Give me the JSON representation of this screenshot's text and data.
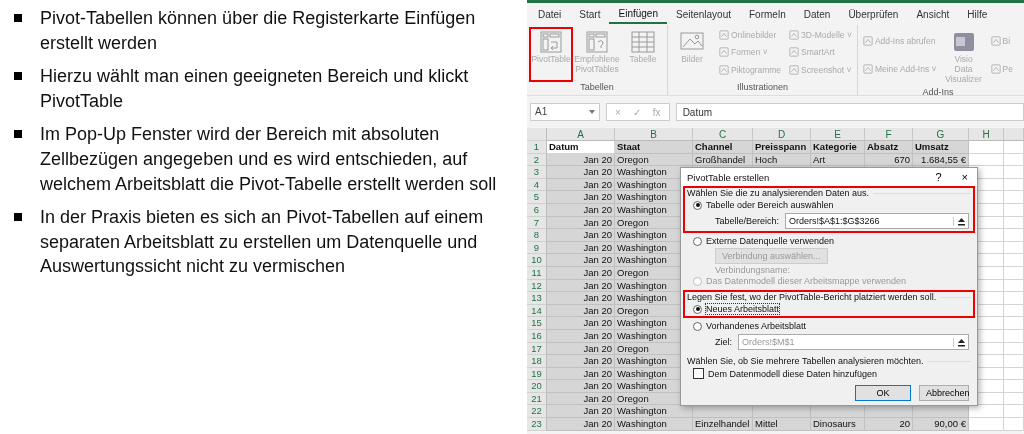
{
  "bullets": [
    "Pivot-Tabellen können über die Registerkarte Einfügen erstellt werden",
    "Hierzu wählt man einen geeigneten Bereich und klickt PivotTable",
    "Im Pop-Up Fenster wird der Bereich mit absoluten Zellbezügen angegeben und es wird entschieden, auf welchem Arbeitsblatt die Pivot-Tabelle erstellt werden soll",
    "In der Praxis bieten es sich an Pivot-Tabellen auf einem separaten Arbeitsblatt zu erstellen um Datenquelle und Auswertungssicht nicht zu vermischen"
  ],
  "excel": {
    "tabs": [
      {
        "label": "Datei",
        "selected": false
      },
      {
        "label": "Start",
        "selected": false
      },
      {
        "label": "Einfügen",
        "selected": true
      },
      {
        "label": "Seitenlayout",
        "selected": false
      },
      {
        "label": "Formeln",
        "selected": false
      },
      {
        "label": "Daten",
        "selected": false
      },
      {
        "label": "Überprüfen",
        "selected": false
      },
      {
        "label": "Ansicht",
        "selected": false
      },
      {
        "label": "Hilfe",
        "selected": false
      }
    ],
    "ribbon_groups": [
      {
        "label": "Tabellen",
        "items": [
          {
            "kind": "large",
            "label": "PivotTable",
            "highlighted": true
          },
          {
            "kind": "large",
            "label": "Empfohlene PivotTables",
            "highlighted": false
          },
          {
            "kind": "large",
            "label": "Tabelle",
            "highlighted": false
          }
        ]
      },
      {
        "label": "Illustrationen",
        "items": [
          {
            "kind": "large",
            "label": "Bilder",
            "highlighted": false
          },
          {
            "kind": "small",
            "label": "Onlinebilder",
            "highlighted": false
          },
          {
            "kind": "small",
            "label": "Formen ˅",
            "highlighted": false
          },
          {
            "kind": "small",
            "label": "Piktogramme",
            "highlighted": false
          },
          {
            "kind": "small",
            "label": "3D-Modelle ˅",
            "highlighted": false
          },
          {
            "kind": "small",
            "label": "SmartArt",
            "highlighted": false
          },
          {
            "kind": "small",
            "label": "Screenshot ˅",
            "highlighted": false
          }
        ]
      },
      {
        "label": "Add-Ins",
        "items": [
          {
            "kind": "small",
            "label": "Add-Ins abrufen",
            "highlighted": false
          },
          {
            "kind": "small",
            "label": "Meine Add-Ins ˅",
            "highlighted": false
          },
          {
            "kind": "large",
            "label": "Visio Data Visualizer",
            "highlighted": false
          },
          {
            "kind": "small",
            "label": "Bi",
            "highlighted": false
          },
          {
            "kind": "small",
            "label": "Pe",
            "highlighted": false
          }
        ]
      }
    ],
    "name_box": "A1",
    "formula_symbols": [
      "×",
      "✓",
      "fx"
    ],
    "formula": "Datum",
    "columns": [
      "A",
      "B",
      "C",
      "D",
      "E",
      "F",
      "G",
      "H"
    ],
    "rows": [
      {
        "num": "1",
        "kind": "header",
        "cells": [
          "Datum",
          "Staat",
          "Channel",
          "Preisspann",
          "Kategorie",
          "Absatz",
          "Umsatz"
        ]
      },
      {
        "num": "2",
        "kind": "data",
        "cells": [
          "Jan 20",
          "Oregon",
          "Großhandel",
          "Hoch",
          "Art",
          "670",
          "1.684,55 €"
        ]
      },
      {
        "num": "3",
        "kind": "data",
        "cells": [
          "Jan 20",
          "Washington"
        ]
      },
      {
        "num": "4",
        "kind": "data",
        "cells": [
          "Jan 20",
          "Washington"
        ]
      },
      {
        "num": "5",
        "kind": "data",
        "cells": [
          "Jan 20",
          "Washington"
        ]
      },
      {
        "num": "6",
        "kind": "data",
        "cells": [
          "Jan 20",
          "Washington"
        ]
      },
      {
        "num": "7",
        "kind": "data",
        "cells": [
          "Jan 20",
          "Oregon"
        ]
      },
      {
        "num": "8",
        "kind": "data",
        "cells": [
          "Jan 20",
          "Washington"
        ]
      },
      {
        "num": "9",
        "kind": "data",
        "cells": [
          "Jan 20",
          "Washington"
        ]
      },
      {
        "num": "10",
        "kind": "data",
        "cells": [
          "Jan 20",
          "Washington"
        ]
      },
      {
        "num": "11",
        "kind": "data",
        "cells": [
          "Jan 20",
          "Oregon"
        ]
      },
      {
        "num": "12",
        "kind": "data",
        "cells": [
          "Jan 20",
          "Washington"
        ]
      },
      {
        "num": "13",
        "kind": "data",
        "cells": [
          "Jan 20",
          "Washington"
        ]
      },
      {
        "num": "14",
        "kind": "data",
        "cells": [
          "Jan 20",
          "Oregon"
        ]
      },
      {
        "num": "15",
        "kind": "data",
        "cells": [
          "Jan 20",
          "Washington"
        ]
      },
      {
        "num": "16",
        "kind": "data",
        "cells": [
          "Jan 20",
          "Washington"
        ]
      },
      {
        "num": "17",
        "kind": "data",
        "cells": [
          "Jan 20",
          "Oregon"
        ]
      },
      {
        "num": "18",
        "kind": "data",
        "cells": [
          "Jan 20",
          "Washington"
        ]
      },
      {
        "num": "19",
        "kind": "data",
        "cells": [
          "Jan 20",
          "Washington"
        ]
      },
      {
        "num": "20",
        "kind": "data",
        "cells": [
          "Jan 20",
          "Washington"
        ]
      },
      {
        "num": "21",
        "kind": "data",
        "cells": [
          "Jan 20",
          "Oregon"
        ]
      },
      {
        "num": "22",
        "kind": "data",
        "cells": [
          "Jan 20",
          "Washington"
        ]
      },
      {
        "num": "23",
        "kind": "data",
        "cells": [
          "Jan 20",
          "Washington",
          "Einzelhandel",
          "Mittel",
          "Dinosaurs",
          "20",
          "90,00 €"
        ]
      }
    ],
    "dialog": {
      "title": "PivotTable erstellen",
      "help": "?",
      "close": "×",
      "sections": [
        {
          "legend": "Wählen Sie die zu analysierenden Daten aus.",
          "highlighted": true,
          "items": [
            {
              "kind": "radio",
              "label": "Tabelle oder Bereich auswählen",
              "selected": true,
              "disabled": false
            },
            {
              "kind": "field",
              "label": "Tabelle/Bereich:",
              "value": "Orders!$A$1:$G$3266",
              "disabled": false
            }
          ]
        },
        {
          "highlighted": false,
          "items": [
            {
              "kind": "radio",
              "label": "Externe Datenquelle verwenden",
              "selected": false,
              "disabled": false
            },
            {
              "kind": "button",
              "label": "Verbindung auswählen...",
              "disabled": true
            },
            {
              "kind": "text",
              "label": "Verbindungsname:",
              "disabled": true
            },
            {
              "kind": "radio",
              "label": "Das Datenmodell dieser Arbeitsmappe verwenden",
              "selected": false,
              "disabled": true
            }
          ]
        },
        {
          "legend": "Legen Sie fest, wo der PivotTable-Bericht platziert werden soll.",
          "highlighted": true,
          "items": [
            {
              "kind": "radio",
              "label": "Neues Arbeitsblatt",
              "selected": true,
              "disabled": false
            }
          ]
        },
        {
          "highlighted": false,
          "items": [
            {
              "kind": "radio",
              "label": "Vorhandenes Arbeitsblatt",
              "selected": false,
              "disabled": false
            },
            {
              "kind": "field",
              "label": "Ziel:",
              "value": "Orders!$M$1",
              "disabled": true
            }
          ]
        },
        {
          "legend": "Wählen Sie, ob Sie mehrere Tabellen analysieren möchten.",
          "highlighted": false,
          "items": [
            {
              "kind": "checkbox",
              "label": "Dem Datenmodell diese Daten hinzufügen",
              "checked": false,
              "disabled": false
            }
          ]
        }
      ],
      "buttons": [
        {
          "label": "OK",
          "default": true
        },
        {
          "label": "Abbrechen",
          "default": false
        }
      ]
    }
  }
}
